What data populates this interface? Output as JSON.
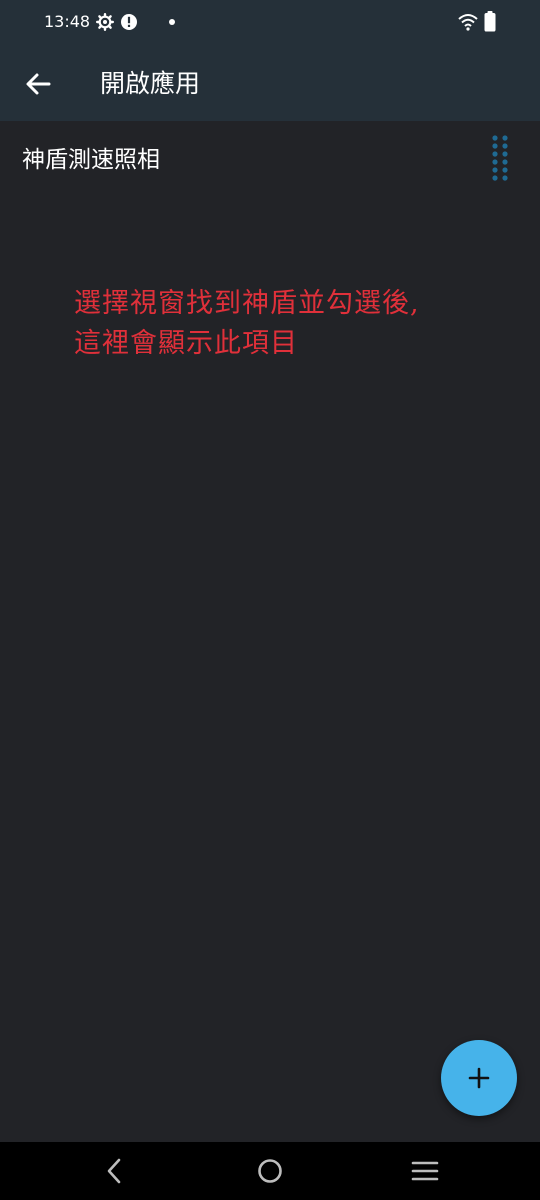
{
  "status_bar": {
    "time": "13:48",
    "icons": [
      "settings-gear-icon",
      "alert-circle-icon",
      "notification-dot-icon",
      "wifi-icon",
      "battery-icon"
    ]
  },
  "app_bar": {
    "title": "開啟應用",
    "back_icon": "arrow-back-icon",
    "background": "#253039"
  },
  "list": {
    "items": [
      {
        "label": "神盾測速照相",
        "handle_icon": "drag-handle-icon"
      }
    ]
  },
  "annotation": {
    "line1": "選擇視窗找到神盾並勾選後,",
    "line2": "這裡會顯示此項目",
    "color": "#e0303a"
  },
  "fab": {
    "icon": "plus-icon",
    "color": "#46b3ea"
  },
  "nav_bar": {
    "icons": [
      "nav-back-icon",
      "nav-home-icon",
      "nav-recents-icon"
    ]
  },
  "colors": {
    "background": "#222327",
    "handle_dots": "#1f6a93"
  }
}
